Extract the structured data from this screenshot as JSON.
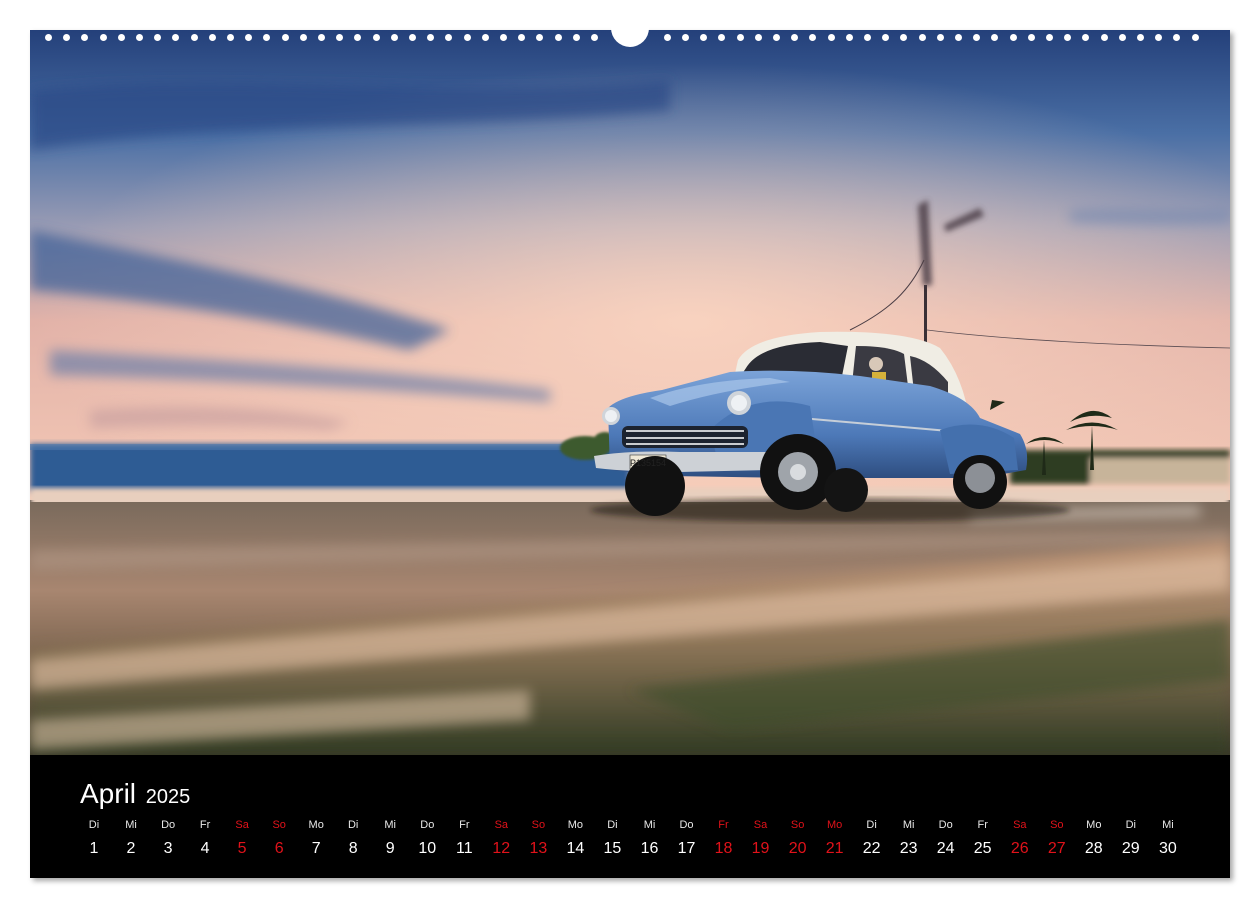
{
  "calendar": {
    "month": "April",
    "year": "2025",
    "days": [
      {
        "dow": "Di",
        "day": "1",
        "holiday": false
      },
      {
        "dow": "Mi",
        "day": "2",
        "holiday": false
      },
      {
        "dow": "Do",
        "day": "3",
        "holiday": false
      },
      {
        "dow": "Fr",
        "day": "4",
        "holiday": false
      },
      {
        "dow": "Sa",
        "day": "5",
        "holiday": true
      },
      {
        "dow": "So",
        "day": "6",
        "holiday": true
      },
      {
        "dow": "Mo",
        "day": "7",
        "holiday": false
      },
      {
        "dow": "Di",
        "day": "8",
        "holiday": false
      },
      {
        "dow": "Mi",
        "day": "9",
        "holiday": false
      },
      {
        "dow": "Do",
        "day": "10",
        "holiday": false
      },
      {
        "dow": "Fr",
        "day": "11",
        "holiday": false
      },
      {
        "dow": "Sa",
        "day": "12",
        "holiday": true
      },
      {
        "dow": "So",
        "day": "13",
        "holiday": true
      },
      {
        "dow": "Mo",
        "day": "14",
        "holiday": false
      },
      {
        "dow": "Di",
        "day": "15",
        "holiday": false
      },
      {
        "dow": "Mi",
        "day": "16",
        "holiday": false
      },
      {
        "dow": "Do",
        "day": "17",
        "holiday": false
      },
      {
        "dow": "Fr",
        "day": "18",
        "holiday": true
      },
      {
        "dow": "Sa",
        "day": "19",
        "holiday": true
      },
      {
        "dow": "So",
        "day": "20",
        "holiday": true
      },
      {
        "dow": "Mo",
        "day": "21",
        "holiday": true
      },
      {
        "dow": "Di",
        "day": "22",
        "holiday": false
      },
      {
        "dow": "Mi",
        "day": "23",
        "holiday": false
      },
      {
        "dow": "Do",
        "day": "24",
        "holiday": false
      },
      {
        "dow": "Fr",
        "day": "25",
        "holiday": false
      },
      {
        "dow": "Sa",
        "day": "26",
        "holiday": true
      },
      {
        "dow": "So",
        "day": "27",
        "holiday": true
      },
      {
        "dow": "Mo",
        "day": "28",
        "holiday": false
      },
      {
        "dow": "Di",
        "day": "29",
        "holiday": false
      },
      {
        "dow": "Mi",
        "day": "30",
        "holiday": false
      }
    ]
  },
  "photo": {
    "license_plate": "P135154"
  },
  "colors": {
    "holiday_red": "#e1121a",
    "calendar_bg": "#000000",
    "car_blue": "#5a86c4"
  }
}
